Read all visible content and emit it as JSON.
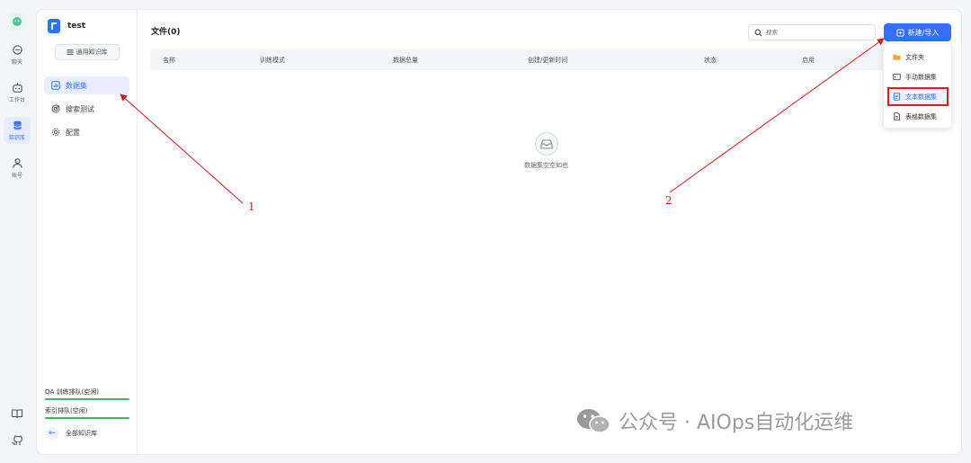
{
  "rail": {
    "items": [
      {
        "label": "聊天",
        "icon": "chat-icon"
      },
      {
        "label": "工作台",
        "icon": "robot-icon"
      },
      {
        "label": "知识库",
        "icon": "database-icon",
        "active": true
      },
      {
        "label": "账号",
        "icon": "user-icon"
      }
    ],
    "bottom_icons": [
      "book-icon",
      "github-icon"
    ]
  },
  "sidebar": {
    "kb_name": "test",
    "kb_type": "通用知识库",
    "nav": [
      {
        "label": "数据集",
        "icon": "chart-icon",
        "active": true
      },
      {
        "label": "搜索测试",
        "icon": "target-icon"
      },
      {
        "label": "配置",
        "icon": "gear-icon"
      }
    ],
    "queues": [
      "QA 训练排队(空闲)",
      "索引排队(空闲)"
    ],
    "back_label": "全部知识库"
  },
  "main": {
    "file_title": "文件(0)",
    "search_placeholder": "搜索",
    "new_button": "新建/导入",
    "columns": [
      "名称",
      "训练模式",
      "数据总量",
      "创建/更新时间",
      "状态",
      "启用"
    ],
    "empty_text": "数据集空空如也"
  },
  "dropdown": {
    "items": [
      {
        "label": "文件夹",
        "icon": "folder-icon"
      },
      {
        "label": "手动数据集",
        "icon": "manual-dataset-icon"
      },
      {
        "label": "文本数据集",
        "icon": "text-dataset-icon",
        "highlighted": true
      },
      {
        "label": "表格数据集",
        "icon": "table-dataset-icon"
      }
    ]
  },
  "annotations": [
    "1",
    "2"
  ],
  "watermark": "公众号 · AIOps自动化运维",
  "colors": {
    "accent": "#3370ff",
    "annotation": "#d21b1b",
    "queue_bar": "#3cba6b",
    "folder": "#f5a623"
  }
}
